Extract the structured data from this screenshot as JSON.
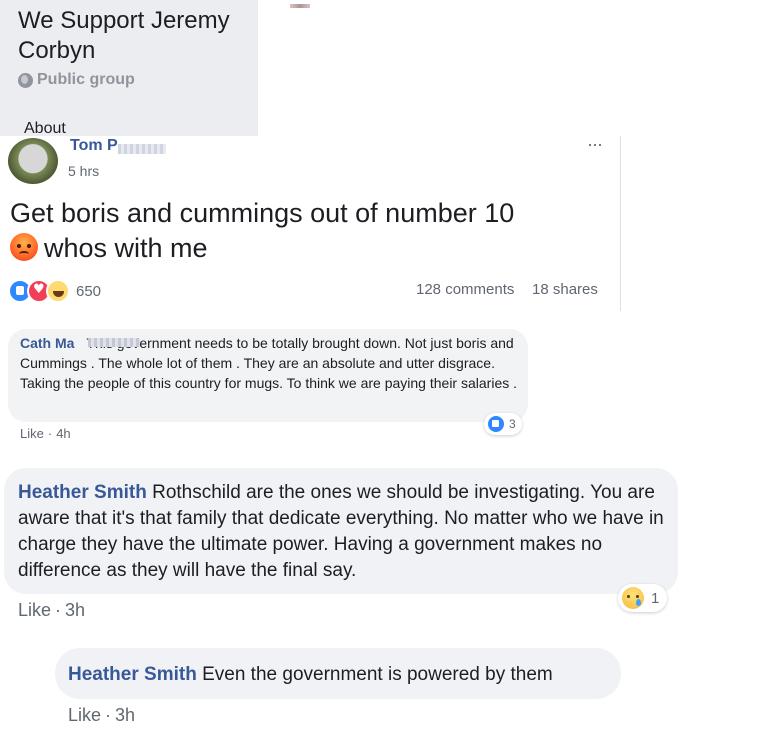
{
  "group": {
    "title": "We Support Jeremy Corbyn",
    "privacy": "Public group",
    "about_tab": "About"
  },
  "post": {
    "author": "Tom P",
    "time": "5 hrs",
    "text_line1": "Get boris and cummings out of number 10",
    "text_line2": "whos with me",
    "reaction_count": "650",
    "comments": "128 comments",
    "shares": "18 shares",
    "more_icon": "···"
  },
  "comments": [
    {
      "author": "Cath Ma",
      "text": "This government needs to be totally brought down. Not just boris and Cummings . The whole lot of them . They are an absolute and utter disgrace. Taking the people of this country for mugs. To think we are paying their salaries .",
      "like_label": "Like",
      "time": "4h",
      "reaction_count": "3"
    },
    {
      "author": "Heather Smith",
      "text": "Rothschild are the ones we should be investigating. You are aware that it's that family that dedicate everything. No matter who we have in charge they have the ultimate power. Having a government makes no difference as they will have the final say.",
      "like_label": "Like",
      "time": "3h",
      "reaction_count": "1"
    }
  ],
  "reply": {
    "author": "Heather Smith",
    "text": "Even the government is powered by them",
    "like_label": "Like",
    "time": "3h"
  },
  "colors": {
    "name_link": "#385898",
    "meta": "#606770",
    "bubble": "#f0f2f5",
    "like_blue": "#2e89ff"
  }
}
